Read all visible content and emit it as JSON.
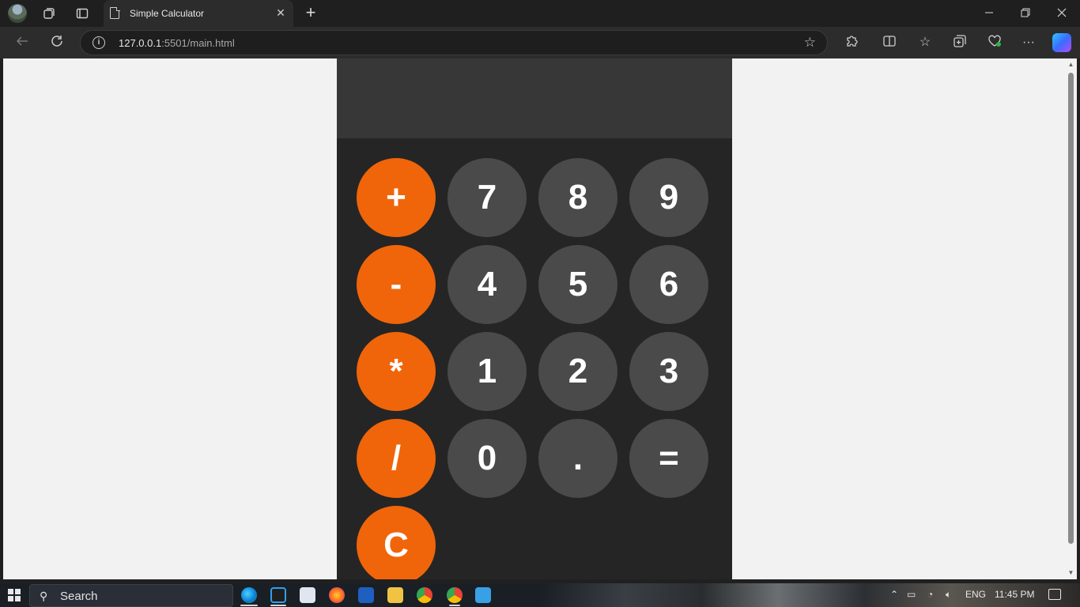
{
  "browser": {
    "tab_title": "Simple Calculator",
    "tab_close": "✕",
    "new_tab": "+",
    "url_host": "127.0.0.1",
    "url_rest": ":5501/main.html"
  },
  "calculator": {
    "display": "",
    "keys": [
      {
        "label": "+",
        "kind": "op"
      },
      {
        "label": "7",
        "kind": "num"
      },
      {
        "label": "8",
        "kind": "num"
      },
      {
        "label": "9",
        "kind": "num"
      },
      {
        "label": "-",
        "kind": "op"
      },
      {
        "label": "4",
        "kind": "num"
      },
      {
        "label": "5",
        "kind": "num"
      },
      {
        "label": "6",
        "kind": "num"
      },
      {
        "label": "*",
        "kind": "op"
      },
      {
        "label": "1",
        "kind": "num"
      },
      {
        "label": "2",
        "kind": "num"
      },
      {
        "label": "3",
        "kind": "num"
      },
      {
        "label": "/",
        "kind": "op"
      },
      {
        "label": "0",
        "kind": "num"
      },
      {
        "label": ".",
        "kind": "num"
      },
      {
        "label": "=",
        "kind": "num"
      },
      {
        "label": "C",
        "kind": "op"
      }
    ],
    "colors": {
      "operator": "#f0650a",
      "number": "#4a4a4a",
      "body": "#252525",
      "display": "#373737"
    }
  },
  "taskbar": {
    "search_placeholder": "Search",
    "language": "ENG",
    "time": "11:45 PM"
  }
}
